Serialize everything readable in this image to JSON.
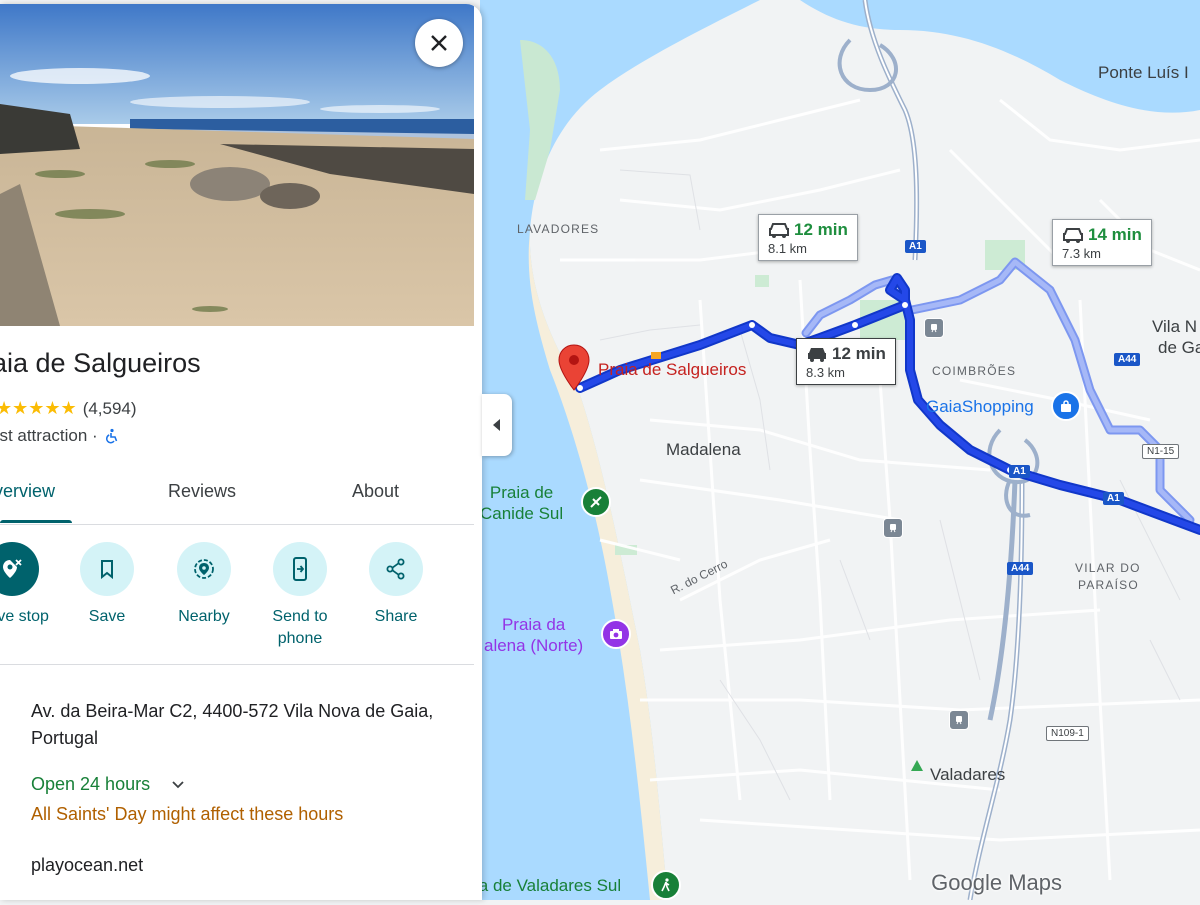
{
  "place": {
    "title": "aia de Salgueiros",
    "stars": "★★★★★",
    "review_count": "(4,594)",
    "category": "rist attraction ·",
    "photo_alt": "beach photo"
  },
  "tabs": [
    {
      "label": "verview"
    },
    {
      "label": "Reviews"
    },
    {
      "label": "About"
    }
  ],
  "actions": [
    {
      "label": "move stop",
      "icon": "remove-stop-icon"
    },
    {
      "label": "Save",
      "icon": "bookmark-icon"
    },
    {
      "label": "Nearby",
      "icon": "nearby-icon"
    },
    {
      "label": "Send to phone",
      "icon": "send-to-phone-icon"
    },
    {
      "label": "Share",
      "icon": "share-icon"
    }
  ],
  "info": {
    "address": "Av. da Beira-Mar C2, 4400-572 Vila Nova de Gaia, Portugal",
    "hours": "Open 24 hours",
    "hours_warning": "All Saints' Day might affect these hours",
    "website": "playocean.net"
  },
  "map": {
    "pin_label": "Praia de Salgueiros",
    "places": {
      "madalena": "Madalena",
      "valadares": "Valadares",
      "ponte": "Ponte Luís I",
      "vila_nova_1": "Vila N",
      "vila_nova_2": "de Ga",
      "gaiashopping": "GaiaShopping"
    },
    "areas": {
      "lavadores": "LAVADORES",
      "coimbroes": "COIMBRÕES",
      "vilar1": "VILAR DO",
      "vilar2": "PARAÍSO"
    },
    "beaches": {
      "canide": "Praia de\nCanide Sul",
      "madalena_norte": "Praia da\nalena (Norte)",
      "valadares": "ia de Valadares Sul"
    },
    "street": "R. do Cerro",
    "shields": {
      "a1": "A1",
      "a44": "A44",
      "n115": "N1-15",
      "n1091": "N109-1"
    },
    "routes": [
      {
        "time": "12 min",
        "distance": "8.1 km",
        "type": "alt"
      },
      {
        "time": "14 min",
        "distance": "7.3 km",
        "type": "alt"
      },
      {
        "time": "12 min",
        "distance": "8.3 km",
        "type": "main"
      }
    ],
    "logo": "Google Maps"
  },
  "colors": {
    "water": "#aadaff",
    "route_main": "#1a3edc",
    "route_alt": "#8fa9f6",
    "accent": "#00626c"
  }
}
